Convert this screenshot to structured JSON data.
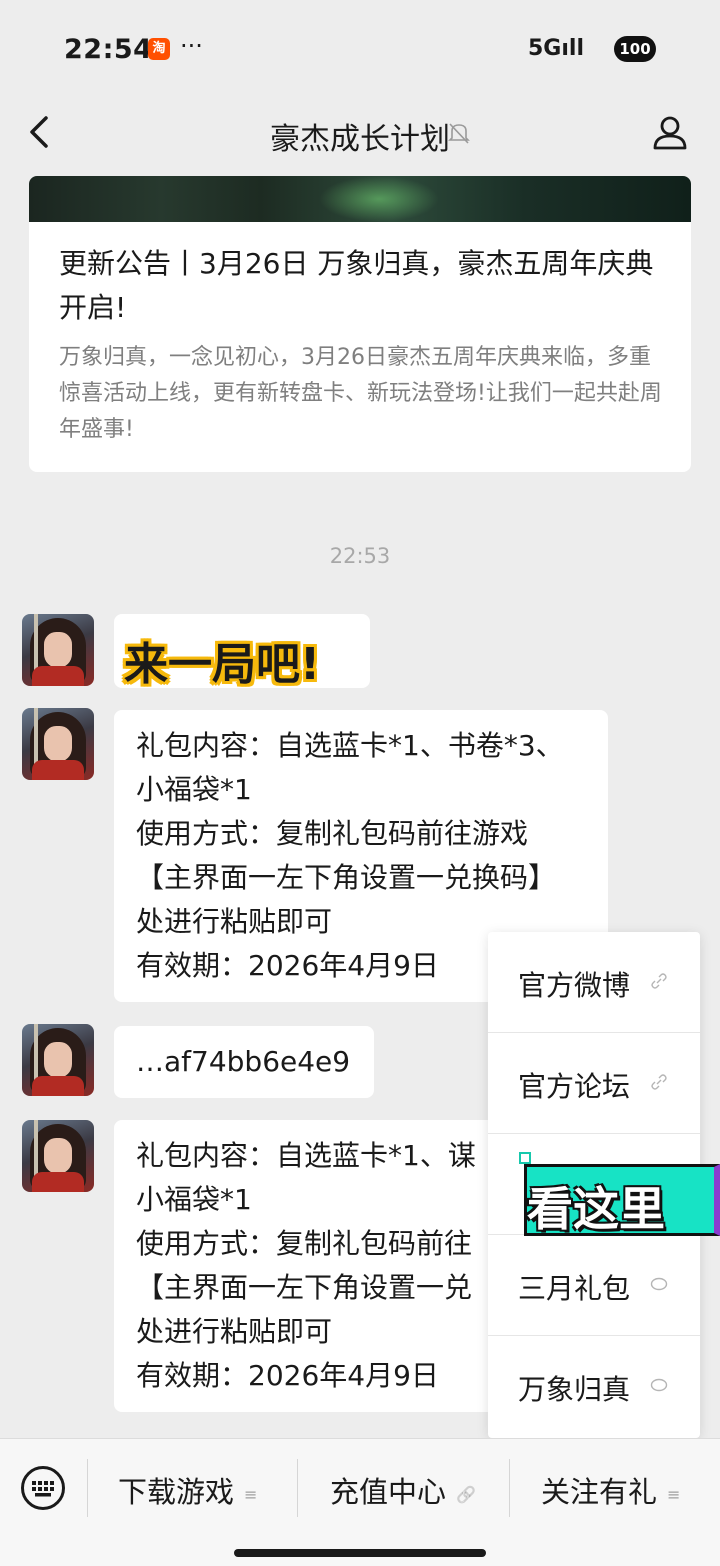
{
  "status_bar": {
    "time": "22:54",
    "app_badge": "淘",
    "more": "···",
    "network": "5Gıll",
    "battery": "100"
  },
  "nav": {
    "title": "豪杰成长计划"
  },
  "article_card": {
    "title": "更新公告丨3月26日 万象归真，豪杰五周年庆典开启!",
    "description": "万象归真，一念见初心，3月26日豪杰五周年庆典来临，多重惊喜活动上线，更有新转盘卡、新玩法登场!让我们一起共赴周年盛事!"
  },
  "chat": {
    "timestamp": "22:53",
    "messages": [
      {
        "sticker_text": "来一局吧!"
      },
      {
        "text": "礼包内容：自选蓝卡*1、书卷*3、\n小福袋*1\n使用方式：复制礼包码前往游戏\n【主界面一左下角设置一兑换码】\n处进行粘贴即可\n有效期：2026年4月9日"
      },
      {
        "text": "…af74bb6e4e9"
      },
      {
        "text": "礼包内容：自选蓝卡*1、谋\n小福袋*1\n使用方式：复制礼包码前往\n【主界面一左下角设置一兑\n处进行粘贴即可\n有效期：2026年4月9日"
      }
    ]
  },
  "popup_menu": {
    "items": [
      {
        "label": "官方微博",
        "icon": "link-icon"
      },
      {
        "label": "官方论坛",
        "icon": "link-icon"
      },
      {
        "label": "",
        "icon": ""
      },
      {
        "label": "三月礼包",
        "icon": "chat-bubble-icon"
      },
      {
        "label": "万象归真",
        "icon": "chat-bubble-icon"
      }
    ]
  },
  "overlay_sticker": {
    "text": "看这里",
    "color": "#17e3c5"
  },
  "bottom_menu": {
    "items": [
      {
        "label": "下载游戏",
        "mark": "≡"
      },
      {
        "label": "充值中心",
        "mark": "🔗"
      },
      {
        "label": "关注有礼",
        "mark": "≡"
      }
    ]
  }
}
